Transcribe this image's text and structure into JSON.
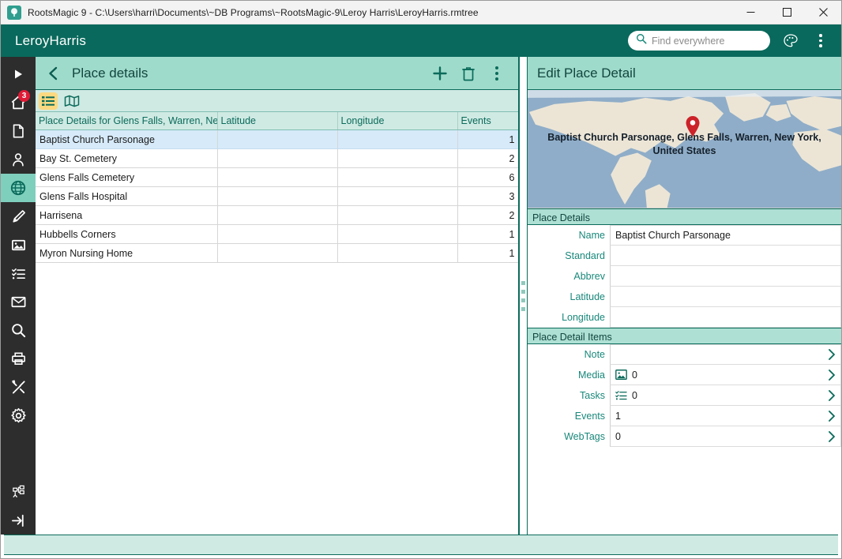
{
  "window": {
    "title": "RootsMagic 9 - C:\\Users\\harri\\Documents\\~DB Programs\\~RootsMagic-9\\Leroy Harris\\LeroyHarris.rmtree",
    "app_icon": "tree-icon",
    "minimize_label": "–",
    "maximize_label": "□",
    "close_label": "✕"
  },
  "brandbar": {
    "database_name": "LeroyHarris",
    "search": {
      "placeholder": "Find everywhere",
      "value": "",
      "icon": "search-icon"
    },
    "palette_icon": "palette-icon",
    "overflow_icon": "kebab-menu-icon"
  },
  "rail": {
    "items": [
      {
        "name": "play-icon",
        "label": ""
      },
      {
        "name": "home-icon",
        "label": "",
        "badge": "3"
      },
      {
        "name": "document-icon",
        "label": ""
      },
      {
        "name": "person-icon",
        "label": ""
      },
      {
        "name": "globe-icon",
        "label": "",
        "active": true
      },
      {
        "name": "pen-icon",
        "label": ""
      },
      {
        "name": "image-icon",
        "label": ""
      },
      {
        "name": "tasks-icon",
        "label": ""
      },
      {
        "name": "mail-icon",
        "label": ""
      },
      {
        "name": "search-icon",
        "label": ""
      },
      {
        "name": "print-icon",
        "label": ""
      },
      {
        "name": "tools-icon",
        "label": ""
      },
      {
        "name": "gear-icon",
        "label": ""
      }
    ],
    "bottom_items": [
      {
        "name": "chart-tree-icon",
        "label": ""
      },
      {
        "name": "exit-icon",
        "label": ""
      }
    ]
  },
  "left_panel": {
    "title": "Place details",
    "back_icon": "chevron-left-icon",
    "add_icon": "plus-icon",
    "delete_icon": "trash-icon",
    "overflow_icon": "kebab-menu-icon",
    "view_modes": [
      {
        "name": "list-view-toggle",
        "icon": "list-icon",
        "active": true
      },
      {
        "name": "map-view-toggle",
        "icon": "map-icon",
        "active": false
      }
    ],
    "table": {
      "columns": [
        "Place Details for Glens Falls, Warren, New Y",
        "Latitude",
        "Longitude",
        "Events"
      ],
      "rows": [
        {
          "name": "Baptist Church Parsonage",
          "latitude": "",
          "longitude": "",
          "events": "1",
          "selected": true
        },
        {
          "name": "Bay St. Cemetery",
          "latitude": "",
          "longitude": "",
          "events": "2",
          "selected": false
        },
        {
          "name": "Glens Falls Cemetery",
          "latitude": "",
          "longitude": "",
          "events": "6",
          "selected": false
        },
        {
          "name": "Glens Falls Hospital",
          "latitude": "",
          "longitude": "",
          "events": "3",
          "selected": false
        },
        {
          "name": "Harrisena",
          "latitude": "",
          "longitude": "",
          "events": "2",
          "selected": false
        },
        {
          "name": "Hubbells Corners",
          "latitude": "",
          "longitude": "",
          "events": "1",
          "selected": false
        },
        {
          "name": "Myron Nursing Home",
          "latitude": "",
          "longitude": "",
          "events": "1",
          "selected": false
        }
      ]
    }
  },
  "right_panel": {
    "title": "Edit Place Detail",
    "map": {
      "caption": "Baptist Church Parsonage, Glens Falls, Warren, New York, United States",
      "pin_icon": "map-pin-icon",
      "water_color": "#8fadc8",
      "land_color": "#ece5d6",
      "pin_color": "#cc2229"
    },
    "place_details": {
      "header": "Place Details",
      "fields": [
        {
          "label": "Name",
          "value": "Baptist Church Parsonage"
        },
        {
          "label": "Standard",
          "value": ""
        },
        {
          "label": "Abbrev",
          "value": ""
        },
        {
          "label": "Latitude",
          "value": ""
        },
        {
          "label": "Longitude",
          "value": ""
        }
      ]
    },
    "place_detail_items": {
      "header": "Place Detail Items",
      "items": [
        {
          "label": "Note",
          "value": "",
          "icon": "",
          "chevron": "chevron-right-icon"
        },
        {
          "label": "Media",
          "value": "0",
          "icon": "image-icon",
          "chevron": "chevron-right-icon"
        },
        {
          "label": "Tasks",
          "value": "0",
          "icon": "tasks-icon",
          "chevron": "chevron-right-icon"
        },
        {
          "label": "Events",
          "value": "1",
          "icon": "",
          "chevron": "chevron-right-icon"
        },
        {
          "label": "WebTags",
          "value": "0",
          "icon": "",
          "chevron": "chevron-right-icon"
        }
      ]
    }
  },
  "statusbar": {
    "text": ""
  },
  "colors": {
    "brand_teal": "#09695c",
    "panel_header_teal": "#9fdbcb",
    "section_teal": "#aee0d4",
    "light_teal": "#cfeae3",
    "rail_dark": "#2d2d2d",
    "active_rail": "#7fcfbd",
    "badge_red": "#e01b36",
    "toggle_yellow": "#fcd980",
    "row_selected_blue": "#d6eaf9"
  }
}
